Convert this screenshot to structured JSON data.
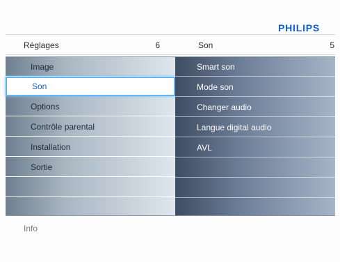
{
  "brand": "PHILIPS",
  "header": {
    "left_title": "Réglages",
    "left_count": "6",
    "right_title": "Son",
    "right_count": "5"
  },
  "left_menu": {
    "items": [
      {
        "label": "Image"
      },
      {
        "label": "Son",
        "selected": true
      },
      {
        "label": "Options"
      },
      {
        "label": "Contrôle parental"
      },
      {
        "label": "Installation"
      },
      {
        "label": "Sortie"
      },
      {
        "label": ""
      },
      {
        "label": ""
      }
    ]
  },
  "right_menu": {
    "items": [
      {
        "label": "Smart son"
      },
      {
        "label": "Mode son"
      },
      {
        "label": "Changer audio"
      },
      {
        "label": "Langue digital audio"
      },
      {
        "label": "AVL"
      },
      {
        "label": ""
      },
      {
        "label": ""
      },
      {
        "label": ""
      }
    ]
  },
  "footer": {
    "info": "Info"
  },
  "colors": {
    "brand": "#0b5ed7",
    "selection_border": "#5fb6f3"
  }
}
